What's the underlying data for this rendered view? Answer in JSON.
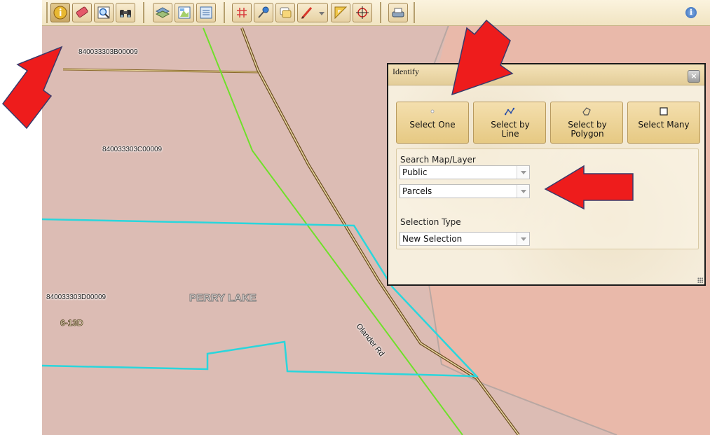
{
  "toolbar": {
    "icons": [
      "identify-icon",
      "eraser-icon",
      "zoom-icon",
      "binoculars-icon",
      "layers-icon",
      "legend-icon",
      "table-icon",
      "grid-icon",
      "pushpin-icon",
      "note-icon",
      "pen-icon",
      "ruler-icon",
      "crosshair-icon",
      "print-icon",
      "info-icon"
    ],
    "info_glyph": "i"
  },
  "map": {
    "parcels": [
      "840033303B00009",
      "840033303C00009",
      "840033303D00009"
    ],
    "lake_label": "PERRY LAKE",
    "code_label": "6-13D",
    "road_label": "Olander Rd",
    "colors": {
      "parcel_fill": "#dcbcb4",
      "lake_fill": "#e9b9aa",
      "boundary": "#2ad6dc",
      "road": "#6fe02a"
    }
  },
  "identify": {
    "title": "Identify",
    "close_glyph": "×",
    "buttons": [
      {
        "label": "Select One"
      },
      {
        "label": "Select by Line"
      },
      {
        "label": "Select by Polygon"
      },
      {
        "label": "Select Many"
      }
    ],
    "search_label": "Search Map/Layer",
    "map_select": "Public",
    "layer_select": "Parcels",
    "selection_type_label": "Selection Type",
    "selection_type": "New Selection"
  }
}
